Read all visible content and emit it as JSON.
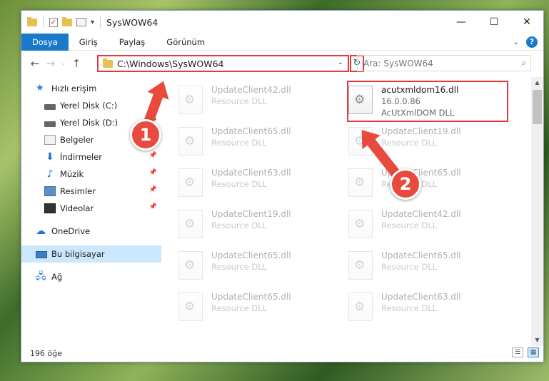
{
  "window": {
    "title": "SysWOW64",
    "controls": {
      "minimize": "—",
      "maximize": "☐",
      "close": "✕"
    }
  },
  "ribbon": {
    "tabs": [
      {
        "label": "Dosya",
        "active": true
      },
      {
        "label": "Giriş",
        "active": false
      },
      {
        "label": "Paylaş",
        "active": false
      },
      {
        "label": "Görünüm",
        "active": false
      }
    ]
  },
  "navigation": {
    "address": "C:\\Windows\\SysWOW64",
    "search_placeholder": "Ara: SysWOW64"
  },
  "sidebar": {
    "items": [
      {
        "label": "Hızlı erişim",
        "icon": "star-icon"
      },
      {
        "label": "Yerel Disk (C:)",
        "icon": "disk-icon",
        "pinned": true
      },
      {
        "label": "Yerel Disk (D:)",
        "icon": "disk-icon",
        "pinned": true
      },
      {
        "label": "Belgeler",
        "icon": "documents-icon",
        "pinned": true
      },
      {
        "label": "İndirmeler",
        "icon": "download-icon",
        "pinned": true
      },
      {
        "label": "Müzik",
        "icon": "music-icon",
        "pinned": true
      },
      {
        "label": "Resimler",
        "icon": "pictures-icon",
        "pinned": true
      },
      {
        "label": "Videolar",
        "icon": "videos-icon",
        "pinned": true
      },
      {
        "label": "OneDrive",
        "icon": "cloud-icon"
      },
      {
        "label": "Bu bilgisayar",
        "icon": "computer-icon",
        "selected": true
      },
      {
        "label": "Ağ",
        "icon": "network-icon"
      }
    ]
  },
  "files": {
    "left": [
      {
        "name": "UpdateClient42.dll",
        "type": "Resource DLL"
      },
      {
        "name": "UpdateClient65.dll",
        "type": "Resource DLL"
      },
      {
        "name": "UpdateClient63.dll",
        "type": "Resource DLL"
      },
      {
        "name": "UpdateClient19.dll",
        "type": "Resource DLL"
      },
      {
        "name": "UpdateClient65.dll",
        "type": "Resource DLL"
      },
      {
        "name": "UpdateClient65.dll",
        "type": "Resource DLL"
      }
    ],
    "right": [
      {
        "name": "acutxmldom16.dll",
        "version": "16.0.0.86",
        "type": "AcUtXmlDOM DLL",
        "highlighted": true
      },
      {
        "name": "UpdateClient19.dll",
        "type": "Resource DLL"
      },
      {
        "name": "UpdateClient65.dll",
        "type": "Resource DLL"
      },
      {
        "name": "UpdateClient42.dll",
        "type": "Resource DLL"
      },
      {
        "name": "UpdateClient65.dll",
        "type": "Resource DLL"
      },
      {
        "name": "UpdateClient63.dll",
        "type": "Resource DLL"
      }
    ]
  },
  "status": {
    "item_count": "196 öğe"
  },
  "annotations": {
    "step1": "1",
    "step2": "2",
    "color": "#e84a3d"
  }
}
